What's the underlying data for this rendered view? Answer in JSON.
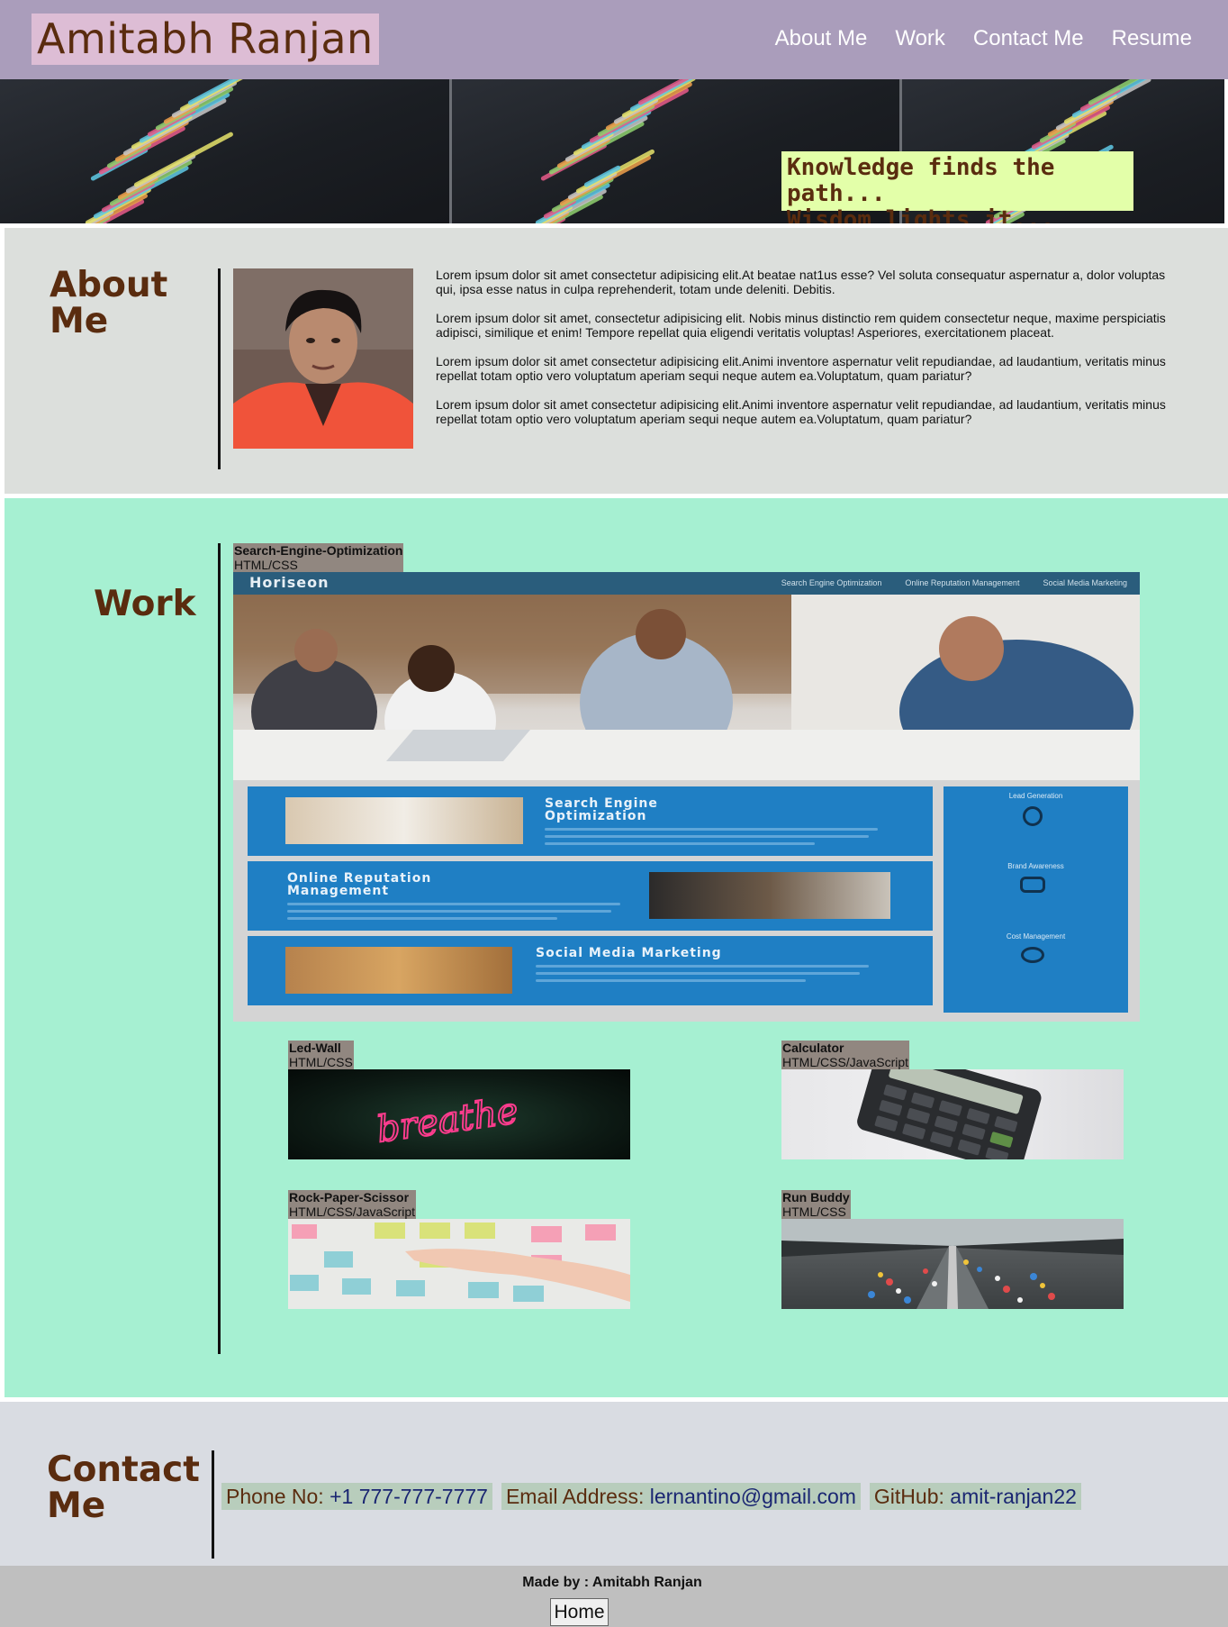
{
  "header": {
    "brand": "Amitabh Ranjan",
    "nav": [
      "About Me",
      "Work",
      "Contact Me",
      "Resume"
    ]
  },
  "hero": {
    "quote_line1": "Knowledge finds the path...",
    "quote_line2": "Wisdom lights it..."
  },
  "about": {
    "title_line1": "About",
    "title_line2": "Me",
    "paragraphs": [
      "Lorem ipsum dolor sit amet consectetur adipisicing elit.At beatae nat1us esse? Vel soluta consequatur aspernatur a, dolor voluptas qui, ipsa esse natus in culpa reprehenderit, totam unde deleniti. Debitis.",
      "Lorem ipsum dolor sit amet, consectetur adipisicing elit. Nobis minus distinctio rem quidem consectetur neque, maxime perspiciatis adipisci, similique et enim! Tempore repellat quia eligendi veritatis voluptas! Asperiores, exercitationem placeat.",
      "Lorem ipsum dolor sit amet consectetur adipisicing elit.Animi inventore aspernatur velit repudiandae, ad laudantium, veritatis minus repellat totam optio vero voluptatum aperiam sequi neque autem ea.Voluptatum, quam pariatur?",
      "Lorem ipsum dolor sit amet consectetur adipisicing elit.Animi inventore aspernatur velit repudiandae, ad laudantium, veritatis minus repellat totam optio vero voluptatum aperiam sequi neque autem ea.Voluptatum, quam pariatur?"
    ]
  },
  "work": {
    "title": "Work",
    "featured": {
      "name": "Search-Engine-Optimization",
      "tech": "HTML/CSS",
      "preview": {
        "logo": "Horiseon",
        "menu": [
          "Search Engine Optimization",
          "Online Reputation Management",
          "Social Media Marketing"
        ],
        "blocks": [
          "Search Engine Optimization",
          "Online Reputation Management",
          "Social Media Marketing"
        ],
        "sidebar": [
          "Lead Generation",
          "Brand Awareness",
          "Cost Management"
        ]
      }
    },
    "projects": [
      {
        "name": "Led-Wall",
        "tech": "HTML/CSS",
        "art": "breathe"
      },
      {
        "name": "Calculator",
        "tech": "HTML/CSS/JavaScript"
      },
      {
        "name": "Rock-Paper-Scissor",
        "tech": "HTML/CSS/JavaScript"
      },
      {
        "name": "Run Buddy",
        "tech": "HTML/CSS"
      }
    ]
  },
  "contact": {
    "title_line1": "Contact",
    "title_line2": "Me",
    "phone_label": "Phone No:",
    "phone": "+1 777-777-7777",
    "email_label": "Email Address:",
    "email": "lernantino@gmail.com",
    "github_label": "GitHub:",
    "github": "amit-ranjan22"
  },
  "footer": {
    "made_by": "Made by : Amitabh Ranjan",
    "home_button": "Home"
  }
}
